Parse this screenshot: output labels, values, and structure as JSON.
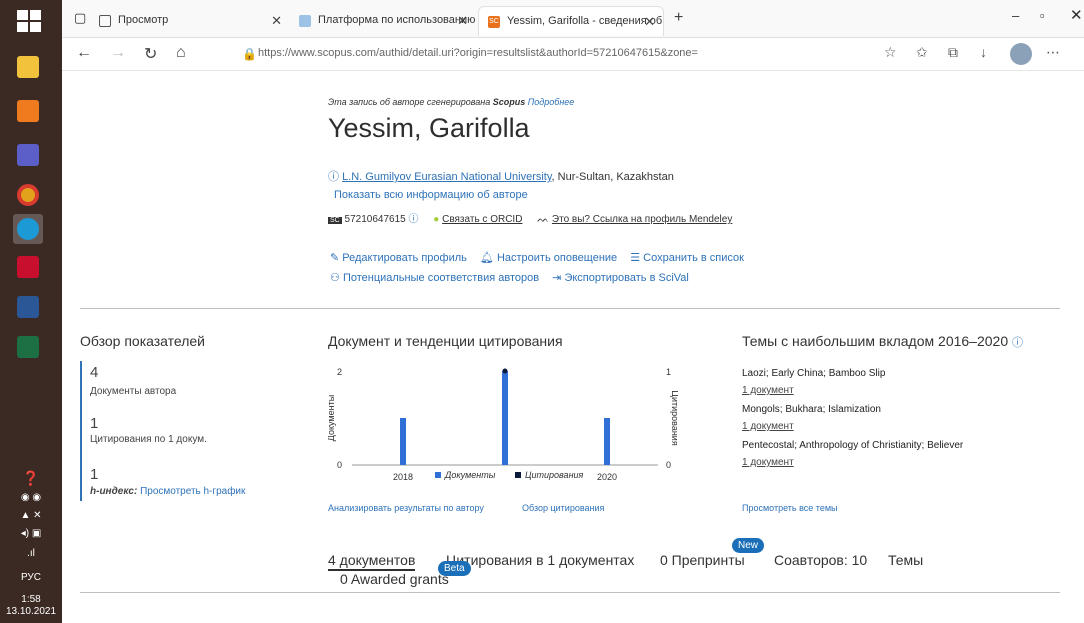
{
  "taskbar": {
    "tray": {
      "lang": "РУС",
      "time": "1:58",
      "date": "13.10.2021"
    }
  },
  "browser": {
    "tabs": [
      {
        "label": "Просмотр"
      },
      {
        "label": "Платформа по использованию"
      },
      {
        "label": "Yessim, Garifolla - сведения об а"
      }
    ],
    "url": "https://www.scopus.com/authid/detail.uri?origin=resultslist&authorId=57210647615&zone="
  },
  "author": {
    "generated_note": "Эта запись об авторе сгенерирована",
    "generated_brand": "Scopus",
    "more_link": "Подробнее",
    "name": "Yessim, Garifolla",
    "affiliation_link": "L.N. Gumilyov Eurasian National University",
    "affiliation_rest": ", Nur-Sultan, Kazakhstan",
    "show_all": "Показать всю информацию об авторе",
    "scopus_id": "57210647615",
    "orcid_link": "Связать с ORCID",
    "mendeley_link": "Это вы? Ссылка на профиль Mendeley"
  },
  "actions": {
    "edit_profile": "Редактировать профиль",
    "set_alert": "Настроить оповещение",
    "save_list": "Сохранить в список",
    "potential_matches": "Потенциальные соответствия авторов",
    "export_scival": "Экспортировать в SciVal"
  },
  "metrics": {
    "heading": "Обзор показателей",
    "docs_value": "4",
    "docs_label": "Документы автора",
    "cites_value": "1",
    "cites_label": "Цитирования по 1 докум.",
    "h_value": "1",
    "h_label": "h-индекс:",
    "h_link": "Просмотреть h-график"
  },
  "trends": {
    "heading": "Документ и тенденции цитирования",
    "analyze_link": "Анализировать результаты по автору",
    "overview_link": "Обзор цитирования"
  },
  "chart_data": {
    "type": "bar",
    "x": [
      2018,
      2019,
      2020
    ],
    "x_ticks": [
      "2018",
      "2020"
    ],
    "series": [
      {
        "name": "Документы",
        "values": [
          1,
          2,
          1
        ],
        "color": "#2f6fd6",
        "axis": "left"
      },
      {
        "name": "Цитирования",
        "values": [
          0,
          1,
          0
        ],
        "color": "#0b1a3a",
        "axis": "right"
      }
    ],
    "ylabel": "Документы",
    "y2label": "Цитирования",
    "ylim": [
      0,
      2
    ],
    "y2lim": [
      0,
      1
    ],
    "yticks": [
      "0",
      "2"
    ],
    "y2ticks": [
      "0",
      "1"
    ],
    "legend": "bottom"
  },
  "topics": {
    "heading": "Темы с наибольшим вкладом 2016–2020",
    "items": [
      {
        "name": "Laozi; Early China; Bamboo Slip",
        "docs": "1 документ"
      },
      {
        "name": "Mongols; Bukhara; Islamization",
        "docs": "1 документ"
      },
      {
        "name": "Pentecostal; Anthropology of Christianity; Believer",
        "docs": "1 документ"
      }
    ],
    "view_all": "Просмотреть все темы"
  },
  "result_tabs": {
    "documents": "4 документов",
    "citations": "Цитирования в 1 документах",
    "beta": "Beta",
    "preprints": "0 Препринты",
    "new": "New",
    "coauthors": "Соавторов: 10",
    "topics": "Темы",
    "grants": "0 Awarded grants"
  }
}
